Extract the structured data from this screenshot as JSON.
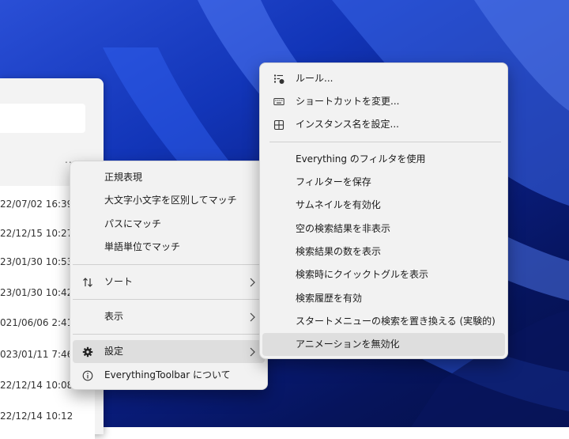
{
  "results": {
    "rows": [
      "22/07/02 16:39",
      "22/12/15 10:27",
      "23/01/30 10:53",
      "23/01/30 10:42",
      "021/06/06 2:41",
      "023/01/11 7:46",
      "22/12/14 10:08",
      "22/12/14 10:12"
    ],
    "more_label": "..."
  },
  "context_menu": {
    "items": [
      {
        "label": "正規表現"
      },
      {
        "label": "大文字小文字を区別してマッチ"
      },
      {
        "label": "パスにマッチ"
      },
      {
        "label": "単語単位でマッチ"
      },
      {
        "label": "ソート",
        "icon": "sort-arrows-icon",
        "submenu": true
      },
      {
        "label": "表示",
        "submenu": true
      },
      {
        "label": "設定",
        "icon": "gear-icon",
        "submenu": true,
        "highlighted": true
      },
      {
        "label": "EverythingToolbar について",
        "icon": "info-icon"
      }
    ]
  },
  "settings_submenu": {
    "items": [
      {
        "label": "ルール...",
        "icon": "rules-icon"
      },
      {
        "label": "ショートカットを変更...",
        "icon": "keyboard-icon"
      },
      {
        "label": "インスタンス名を設定...",
        "icon": "instance-icon"
      },
      {
        "label": "Everything のフィルタを使用"
      },
      {
        "label": "フィルターを保存"
      },
      {
        "label": "サムネイルを有効化"
      },
      {
        "label": "空の検索結果を非表示"
      },
      {
        "label": "検索結果の数を表示"
      },
      {
        "label": "検索時にクイックトグルを表示"
      },
      {
        "label": "検索履歴を有効"
      },
      {
        "label": "スタートメニューの検索を置き換える (実験的)"
      },
      {
        "label": "アニメーションを無効化",
        "highlighted": true
      }
    ]
  },
  "colors": {
    "menu_bg": "#f2f2f2",
    "highlight": "#dedede",
    "wallpaper": "#1235b8"
  }
}
